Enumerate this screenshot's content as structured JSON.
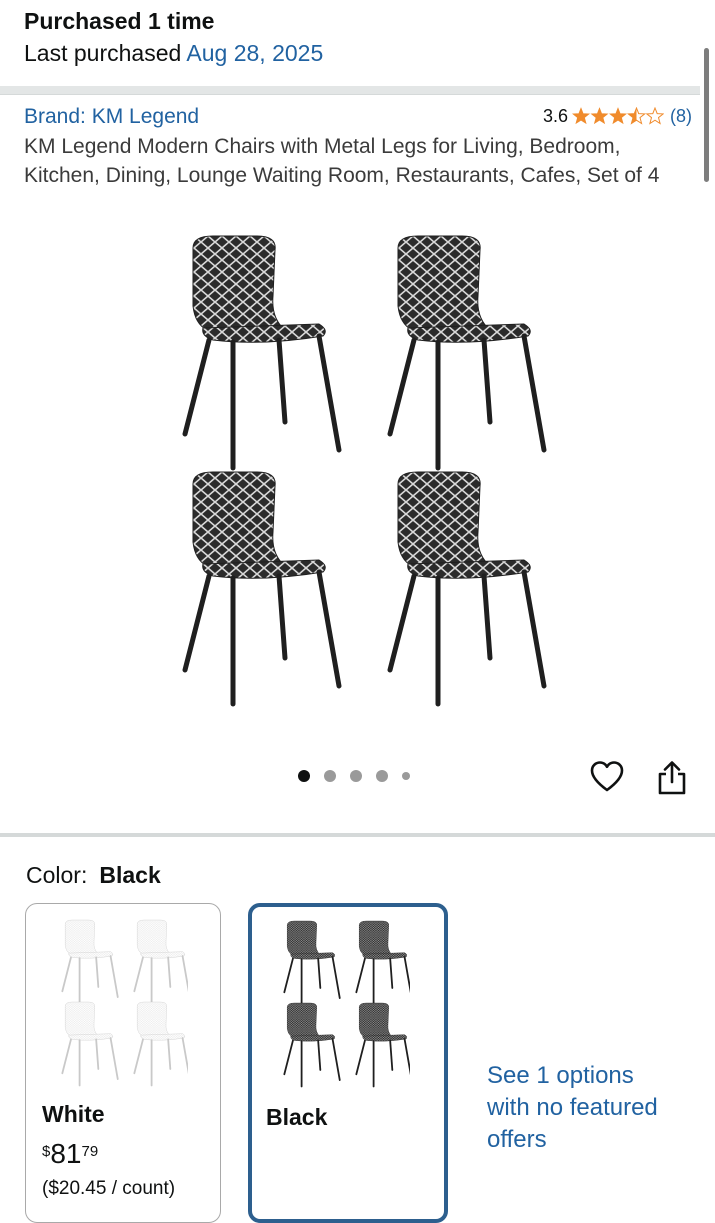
{
  "purchase": {
    "title": "Purchased 1 time",
    "last_label": "Last purchased",
    "last_date": "Aug 28, 2025"
  },
  "product": {
    "brand": "Brand: KM Legend",
    "rating": "3.6",
    "rating_value": 3.6,
    "rating_max": 5,
    "review_count": "(8)",
    "title": "KM Legend Modern Chairs with Metal Legs for Living, Bedroom, Kitchen, Dining, Lounge Waiting Room, Restaurants, Cafes, Set of 4",
    "image_count": 5,
    "active_image": 1
  },
  "color": {
    "label": "Color:",
    "selected": "Black",
    "options": [
      {
        "name": "White",
        "price_symbol": "$",
        "price_whole": "81",
        "price_fraction": "79",
        "unit_price": "($20.45 / count)"
      },
      {
        "name": "Black"
      }
    ],
    "see_offers": "See 1 options with no featured offers"
  },
  "colors": {
    "link": "#2162a1",
    "star": "#f08b2c",
    "selected_border": "#2d5f8e",
    "chair_black": "#2b2b2b",
    "chair_white": "#ffffff"
  },
  "icons": {
    "heart": "heart-icon",
    "share": "share-icon"
  }
}
